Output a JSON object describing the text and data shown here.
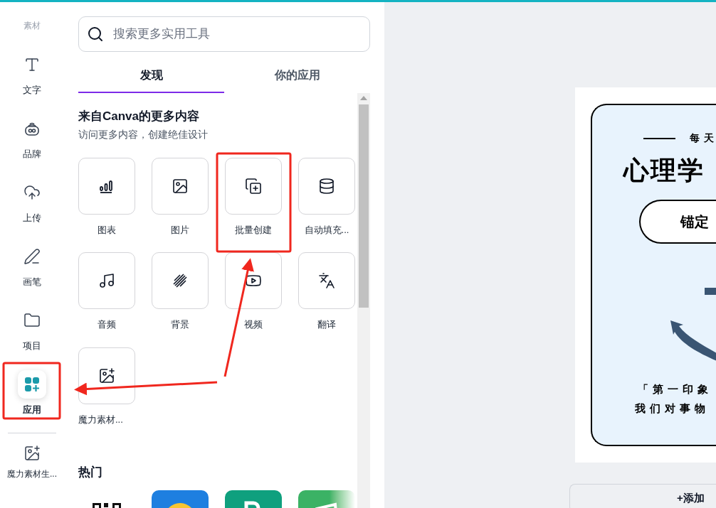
{
  "rail": {
    "heading": "素材",
    "items": [
      {
        "label": "文字",
        "selected": false
      },
      {
        "label": "品牌",
        "selected": false
      },
      {
        "label": "上传",
        "selected": false
      },
      {
        "label": "画笔",
        "selected": false
      },
      {
        "label": "项目",
        "selected": false
      },
      {
        "label": "应用",
        "selected": true
      }
    ],
    "extra": {
      "label": "魔力素材生..."
    }
  },
  "search": {
    "placeholder": "搜索更多实用工具"
  },
  "tabs": [
    {
      "label": "发现",
      "selected": true
    },
    {
      "label": "你的应用",
      "selected": false
    }
  ],
  "section": {
    "title": "来自Canva的更多内容",
    "subtitle": "访问更多内容，创建绝佳设计",
    "tiles": [
      {
        "label": "图表"
      },
      {
        "label": "图片"
      },
      {
        "label": "批量创建"
      },
      {
        "label": "自动填充..."
      },
      {
        "label": "音频"
      },
      {
        "label": "背景"
      },
      {
        "label": "视频"
      },
      {
        "label": "翻译"
      },
      {
        "label": "魔力素材..."
      }
    ]
  },
  "popular": {
    "title": "热门"
  },
  "design": {
    "kicker": "每天",
    "title": "心理学",
    "pill": "锚定",
    "quote_1": "「第一印象",
    "quote_2": "我们对事物"
  },
  "add_page": {
    "label": "+添加"
  }
}
